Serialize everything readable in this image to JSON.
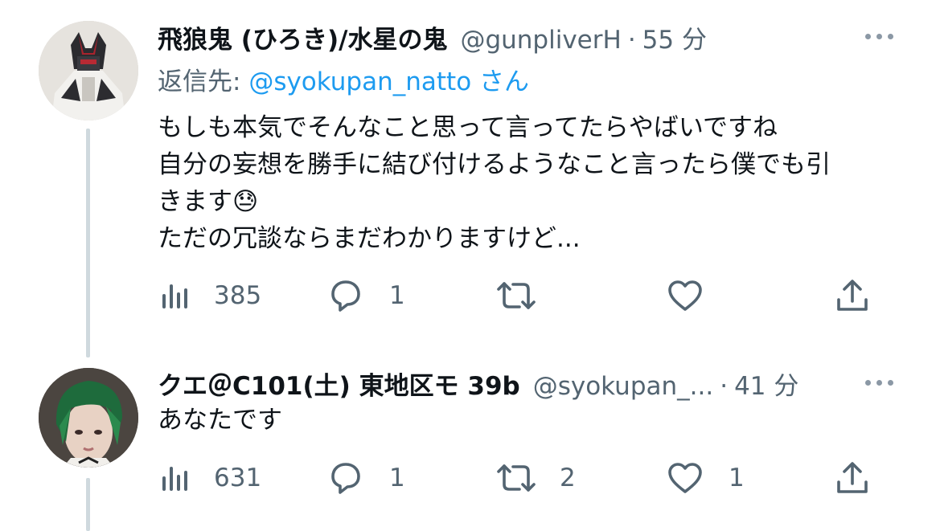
{
  "tweets": [
    {
      "display_name": "飛狼鬼 (ひろき)/水星の鬼",
      "handle": "@gunpliverH",
      "separator": "·",
      "time": "55 分",
      "reply_label": "返信先:",
      "reply_mention": "@syokupan_natto",
      "reply_suffix": "さん",
      "lines": [
        "もしも本気でそんなこと思って言ってたらやばいですね",
        "自分の妄想を勝手に結び付けるようなこと言ったら僕でも引",
        "きます😓",
        "ただの冗談ならまだわかりますけど..."
      ],
      "views": "385",
      "replies": "1",
      "retweets": "",
      "likes": ""
    },
    {
      "display_name": "クエ＠C101(土) 東地区モ 39b",
      "handle": "@syokupan_...",
      "separator": "·",
      "time": "41 分",
      "lines": [
        "あなたです"
      ],
      "views": "631",
      "replies": "1",
      "retweets": "2",
      "likes": "1"
    }
  ],
  "icons": [
    "views-icon",
    "reply-icon",
    "retweet-icon",
    "like-icon",
    "share-icon",
    "more-icon"
  ],
  "colors": {
    "link": "#1d9bf0",
    "secondary": "#536471",
    "thread_line": "#cfd9de"
  }
}
